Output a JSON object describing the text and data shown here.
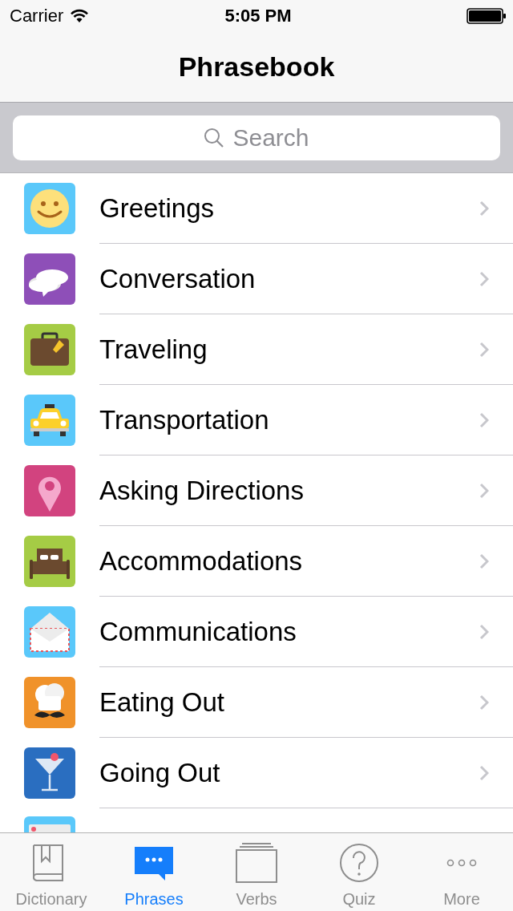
{
  "status_bar": {
    "carrier": "Carrier",
    "time": "5:05 PM"
  },
  "nav_bar": {
    "title": "Phrasebook"
  },
  "search": {
    "placeholder": "Search"
  },
  "categories": [
    {
      "label": "Greetings",
      "kind": "smiley",
      "color": "#5ac8fa"
    },
    {
      "label": "Conversation",
      "kind": "bubbles",
      "color": "#8e4fb8"
    },
    {
      "label": "Traveling",
      "kind": "suitcase",
      "color": "#a5cc45"
    },
    {
      "label": "Transportation",
      "kind": "taxi",
      "color": "#5ac8fa"
    },
    {
      "label": "Asking Directions",
      "kind": "pin",
      "color": "#d2437f"
    },
    {
      "label": "Accommodations",
      "kind": "bed",
      "color": "#a5cc45"
    },
    {
      "label": "Communications",
      "kind": "envelope",
      "color": "#5ac8fa"
    },
    {
      "label": "Eating Out",
      "kind": "chef",
      "color": "#f0922a"
    },
    {
      "label": "Going Out",
      "kind": "cocktail",
      "color": "#2a6ec0"
    },
    {
      "kind": "ticket",
      "color": "#5ac8fa"
    }
  ],
  "tabs": [
    {
      "label": "Dictionary",
      "kind": "book",
      "selected": false
    },
    {
      "label": "Phrases",
      "kind": "chat",
      "selected": true
    },
    {
      "label": "Verbs",
      "kind": "stack",
      "selected": false
    },
    {
      "label": "Quiz",
      "kind": "question",
      "selected": false
    },
    {
      "label": "More",
      "kind": "more",
      "selected": false
    }
  ]
}
